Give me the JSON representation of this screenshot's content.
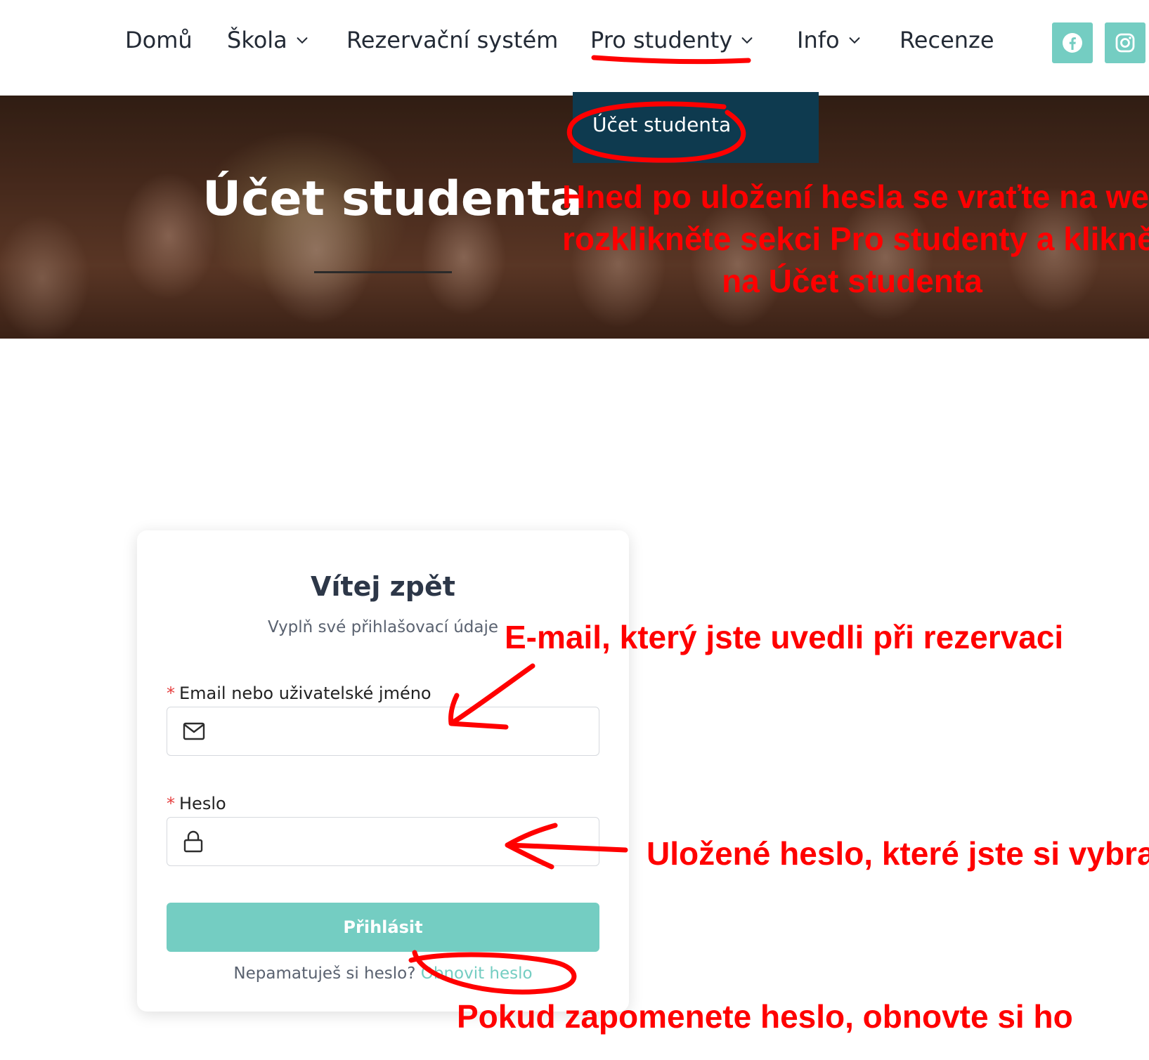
{
  "nav": {
    "items": [
      {
        "label": "Domů",
        "has_dropdown": false
      },
      {
        "label": "Škola",
        "has_dropdown": true
      },
      {
        "label": "Rezervační systém",
        "has_dropdown": false
      },
      {
        "label": "Pro studenty",
        "has_dropdown": true
      },
      {
        "label": "Info",
        "has_dropdown": true
      },
      {
        "label": "Recenze",
        "has_dropdown": false
      }
    ],
    "social": [
      {
        "icon": "facebook-icon"
      },
      {
        "icon": "instagram-icon"
      }
    ]
  },
  "dropdown": {
    "items": [
      {
        "label": "Účet studenta"
      }
    ]
  },
  "hero": {
    "title": "Účet studenta"
  },
  "login": {
    "title": "Vítej zpět",
    "subtitle": "Vyplň své přihlašovací údaje",
    "email_label": "Email nebo uživatelské jméno",
    "email_icon": "envelope-icon",
    "password_label": "Heslo",
    "password_icon": "lock-icon",
    "required_mark": "*",
    "submit_label": "Přihlásit",
    "forgot_text": "Nepamatuješ si heslo?",
    "forgot_link": "Obnovit heslo"
  },
  "annotations": {
    "hero_note_line1": "Hned po uložení hesla se vraťte na web,",
    "hero_note_line2": "rozklikněte sekci Pro studenty a klikněte",
    "hero_note_line3": "na Účet studenta",
    "email_note": "E-mail, který jste uvedli při rezervaci",
    "password_note": "Uložené heslo, které jste si vybrali",
    "forgot_note": "Pokud zapomenete heslo, obnovte si ho",
    "color": "#ff0000"
  },
  "theme": {
    "accent": "#74cdc2",
    "dropdown_bg": "#0e3a4f",
    "text_dark": "#232a35"
  }
}
